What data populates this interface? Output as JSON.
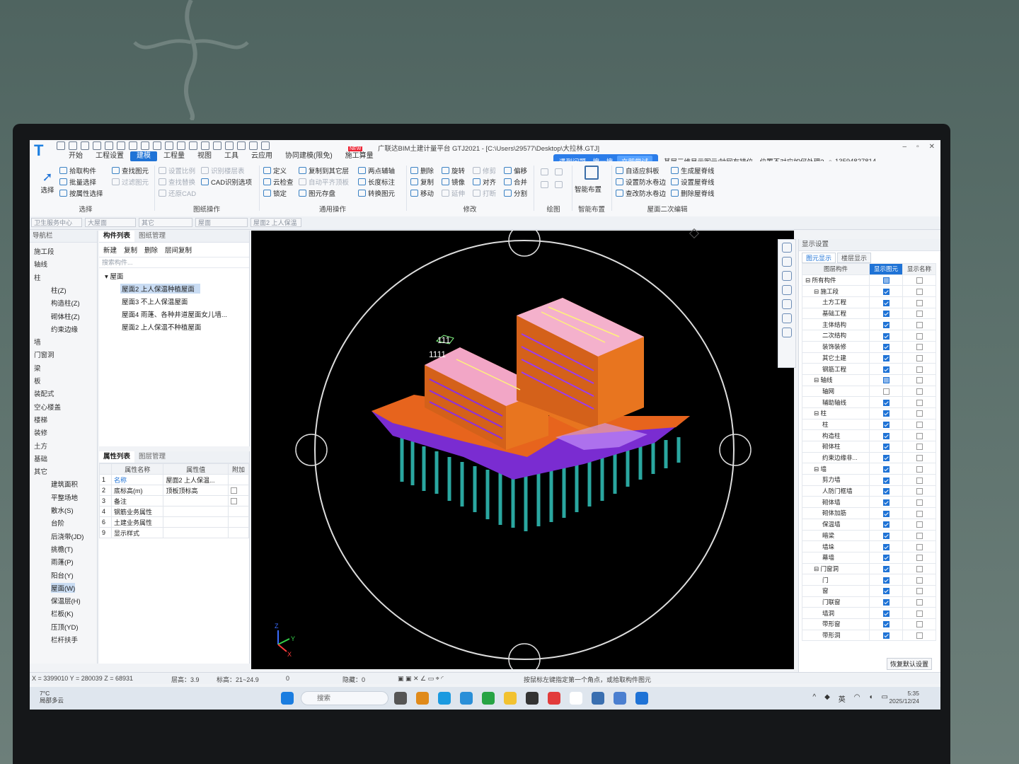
{
  "app": {
    "title": "广联达BIM土建计量平台 GTJ2021 - [C:\\Users\\29577\\Desktop\\大拉林.GTJ]",
    "badge": "NEW",
    "menu": [
      "开始",
      "工程设置",
      "建模",
      "工程量",
      "视图",
      "工具",
      "云应用",
      "协同建模(限免)",
      "施工算量"
    ],
    "active_menu": "建模"
  },
  "help": {
    "tip": "遇到问题，搜一搜",
    "try_label": "立即尝试",
    "question": "基层三维显示图元/轴网有错位，位置不对应如何处理?",
    "account": "13594827814"
  },
  "ribbon": {
    "select": {
      "big": "选择",
      "items": [
        "拾取构件",
        "批量选择",
        "按属性选择"
      ],
      "caption": "选择"
    },
    "find": {
      "items": [
        "查找图元",
        "过滤图元"
      ]
    },
    "drawing": {
      "items": [
        "设置比例",
        "识别楼层表",
        "查找替换",
        "CAD识别选项",
        "还原CAD"
      ],
      "caption": "图纸操作"
    },
    "common": {
      "items": [
        "定义",
        "复制到其它层",
        "两点辅轴",
        "云检查",
        "自动平齐顶板",
        "长度标注",
        "锁定",
        "图元存盘",
        "转换图元"
      ],
      "caption": "通用操作"
    },
    "modify": {
      "items": [
        "删除",
        "旋转",
        "修剪",
        "偏移",
        "复制",
        "镜像",
        "对齐",
        "合并",
        "移动",
        "延伸",
        "打断",
        "分割"
      ],
      "caption": "修改"
    },
    "draw": {
      "caption": "绘图"
    },
    "smart": {
      "big": "智能布置",
      "caption": "智能布置"
    },
    "roof": {
      "items": [
        "自适应斜板",
        "生成屋脊线",
        "设置防水卷边",
        "设置屋脊线",
        "查改防水卷边",
        "删除屋脊线"
      ],
      "caption": "屋面二次编辑"
    }
  },
  "filters": [
    "卫生服务中心",
    "大屋面",
    "其它",
    "屋面",
    "屋面2 上人保温"
  ],
  "nav": {
    "header": "导航栏",
    "items": [
      {
        "label": "施工段",
        "sub": false
      },
      {
        "label": "轴线",
        "sub": false
      },
      {
        "label": "柱",
        "sub": false
      },
      {
        "label": "柱(Z)",
        "sub": true
      },
      {
        "label": "构造柱(Z)",
        "sub": true
      },
      {
        "label": "砌体柱(Z)",
        "sub": true
      },
      {
        "label": "约束边缘",
        "sub": true
      },
      {
        "label": "墙",
        "sub": false
      },
      {
        "label": "门窗洞",
        "sub": false
      },
      {
        "label": "梁",
        "sub": false
      },
      {
        "label": "板",
        "sub": false
      },
      {
        "label": "装配式",
        "sub": false
      },
      {
        "label": "空心楼盖",
        "sub": false
      },
      {
        "label": "楼梯",
        "sub": false
      },
      {
        "label": "装修",
        "sub": false
      },
      {
        "label": "土方",
        "sub": false
      },
      {
        "label": "基础",
        "sub": false
      },
      {
        "label": "其它",
        "sub": false
      },
      {
        "label": "建筑面积",
        "sub": true
      },
      {
        "label": "平整场地",
        "sub": true
      },
      {
        "label": "散水(S)",
        "sub": true
      },
      {
        "label": "台阶",
        "sub": true
      },
      {
        "label": "后浇带(JD)",
        "sub": true
      },
      {
        "label": "挑檐(T)",
        "sub": true
      },
      {
        "label": "雨蓬(P)",
        "sub": true
      },
      {
        "label": "阳台(Y)",
        "sub": true
      },
      {
        "label": "屋面(W)",
        "sub": true
      },
      {
        "label": "保温层(H)",
        "sub": true
      },
      {
        "label": "栏板(K)",
        "sub": true
      },
      {
        "label": "压顶(YD)",
        "sub": true
      },
      {
        "label": "栏杆扶手",
        "sub": true
      }
    ],
    "selected": "屋面(W)"
  },
  "components": {
    "tabs": [
      "构件列表",
      "图纸管理"
    ],
    "tools": [
      "新建",
      "复制",
      "删除",
      "层间复制"
    ],
    "search_placeholder": "搜索构件...",
    "group": "屋面",
    "items": [
      "屋面2 上人保温种植屋面",
      "屋面3 不上人保温屋面",
      "屋面4 雨蓬、各种井道屋面女儿墙...",
      "屋面2 上人保温不种植屋面"
    ],
    "selected": "屋面2 上人保温种植屋面"
  },
  "properties": {
    "tabs": [
      "属性列表",
      "图层管理"
    ],
    "headers": [
      "属性名称",
      "属性值",
      "附加"
    ],
    "rows": [
      {
        "no": "1",
        "name": "名称",
        "value": "屋面2 上人保温..."
      },
      {
        "no": "2",
        "name": "底标高(m)",
        "value": "顶板顶标高"
      },
      {
        "no": "3",
        "name": "备注",
        "value": ""
      },
      {
        "no": "4",
        "name": "钢筋业务属性",
        "value": ""
      },
      {
        "no": "6",
        "name": "土建业务属性",
        "value": ""
      },
      {
        "no": "9",
        "name": "显示样式",
        "value": ""
      }
    ]
  },
  "viewport": {
    "labels": [
      "111",
      "1111"
    ],
    "axes": [
      "Z",
      "Y",
      "X"
    ]
  },
  "display": {
    "title": "显示设置",
    "tabs": [
      "图元显示",
      "楼层显示"
    ],
    "headers": [
      "图层构件",
      "显示图元",
      "显示名称"
    ],
    "rows": [
      {
        "label": "所有构件",
        "level": 0,
        "show": "partial",
        "name": false
      },
      {
        "label": "施工段",
        "level": 1,
        "show": true,
        "name": false
      },
      {
        "label": "土方工程",
        "level": 2,
        "show": true,
        "name": false
      },
      {
        "label": "基础工程",
        "level": 2,
        "show": true,
        "name": false
      },
      {
        "label": "主体结构",
        "level": 2,
        "show": true,
        "name": false
      },
      {
        "label": "二次结构",
        "level": 2,
        "show": true,
        "name": false
      },
      {
        "label": "装饰装修",
        "level": 2,
        "show": true,
        "name": false
      },
      {
        "label": "其它土建",
        "level": 2,
        "show": true,
        "name": false
      },
      {
        "label": "钢筋工程",
        "level": 2,
        "show": true,
        "name": false
      },
      {
        "label": "轴线",
        "level": 1,
        "show": "partial",
        "name": false
      },
      {
        "label": "轴网",
        "level": 2,
        "show": false,
        "name": false
      },
      {
        "label": "辅助轴线",
        "level": 2,
        "show": true,
        "name": false
      },
      {
        "label": "柱",
        "level": 1,
        "show": true,
        "name": false
      },
      {
        "label": "柱",
        "level": 2,
        "show": true,
        "name": false
      },
      {
        "label": "构造柱",
        "level": 2,
        "show": true,
        "name": false
      },
      {
        "label": "砌体柱",
        "level": 2,
        "show": true,
        "name": false
      },
      {
        "label": "约束边缘非...",
        "level": 2,
        "show": true,
        "name": false
      },
      {
        "label": "墙",
        "level": 1,
        "show": true,
        "name": false
      },
      {
        "label": "剪力墙",
        "level": 2,
        "show": true,
        "name": false
      },
      {
        "label": "人防门框墙",
        "level": 2,
        "show": true,
        "name": false
      },
      {
        "label": "砌体墙",
        "level": 2,
        "show": true,
        "name": false
      },
      {
        "label": "砌体加筋",
        "level": 2,
        "show": true,
        "name": false
      },
      {
        "label": "保温墙",
        "level": 2,
        "show": true,
        "name": false
      },
      {
        "label": "暗梁",
        "level": 2,
        "show": true,
        "name": false
      },
      {
        "label": "墙垛",
        "level": 2,
        "show": true,
        "name": false
      },
      {
        "label": "幕墙",
        "level": 2,
        "show": true,
        "name": false
      },
      {
        "label": "门窗洞",
        "level": 1,
        "show": true,
        "name": false
      },
      {
        "label": "门",
        "level": 2,
        "show": true,
        "name": false
      },
      {
        "label": "窗",
        "level": 2,
        "show": true,
        "name": false
      },
      {
        "label": "门联窗",
        "level": 2,
        "show": true,
        "name": false
      },
      {
        "label": "墙洞",
        "level": 2,
        "show": true,
        "name": false
      },
      {
        "label": "带形窗",
        "level": 2,
        "show": true,
        "name": false
      },
      {
        "label": "带形洞",
        "level": 2,
        "show": true,
        "name": false
      }
    ],
    "restore_label": "恢复默认设置"
  },
  "status": {
    "coords": "X = 3399010 Y = 280039 Z = 68931",
    "floor_height": "层高：3.9",
    "elevation": "标高：21~24.9",
    "zero": "0",
    "hidden": "隐藏：0",
    "hint": "按鼠标左键指定第一个角点，或拾取构件图元"
  },
  "taskbar": {
    "weather_temp": "7°C",
    "weather_desc": "局部多云",
    "search": "搜索",
    "lang": "英",
    "time": "5:35",
    "date": "2025/12/24"
  }
}
